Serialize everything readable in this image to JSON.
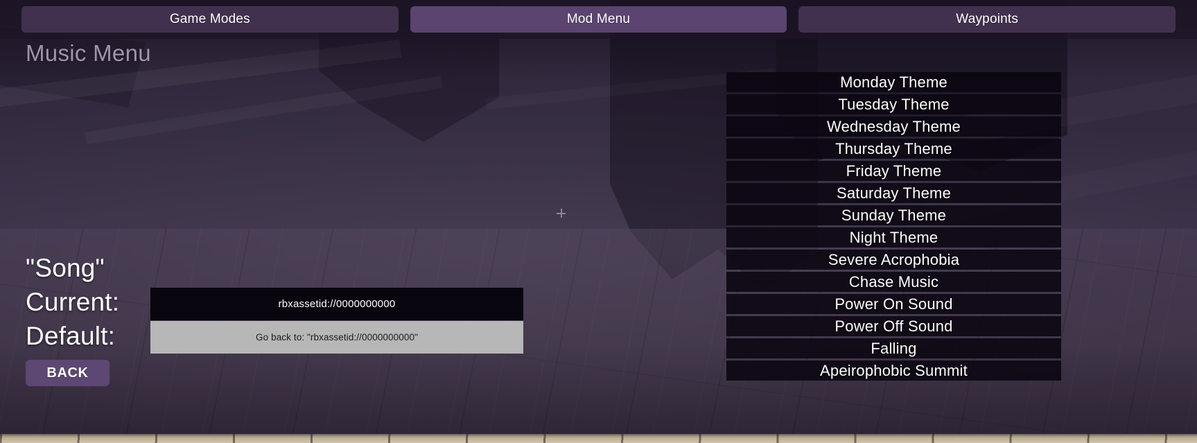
{
  "window": {
    "title": "Music Menu"
  },
  "topbar": {
    "tabs": [
      {
        "label": "Game Modes",
        "active": false
      },
      {
        "label": "Mod Menu",
        "active": true
      },
      {
        "label": "Waypoints",
        "active": false
      }
    ]
  },
  "page": {
    "title": "Music Menu"
  },
  "song_panel": {
    "heading": "\"Song\"",
    "current_label": "Current:",
    "default_label": "Default:",
    "current_value": "rbxassetid://0000000000",
    "default_value": "Go back to: \"rbxassetid://0000000000\"",
    "back_label": "BACK"
  },
  "song_list": {
    "items": [
      "Monday Theme",
      "Tuesday Theme",
      "Wednesday Theme",
      "Thursday Theme",
      "Friday Theme",
      "Saturday Theme",
      "Sunday Theme",
      "Night Theme",
      "Severe Acrophobia",
      "Chase Music",
      "Power On Sound",
      "Power Off Sound",
      "Falling",
      "Apeirophobic Summit"
    ]
  },
  "colors": {
    "tab_inactive": "#41314f",
    "tab_active": "#5b4470",
    "back_button": "#5d4773",
    "field_current_bg": "#0a0610",
    "field_default_bg": "#b7b7b7",
    "page_title_text": "#9e95ab",
    "list_item_bg": "#0a0610"
  }
}
